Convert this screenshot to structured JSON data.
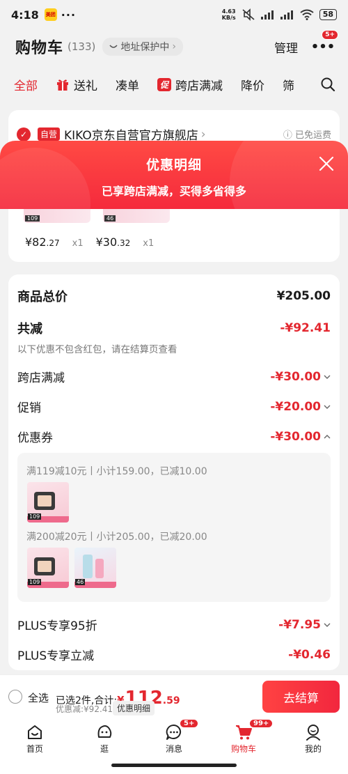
{
  "status_bar": {
    "time": "4:18",
    "app_badge": "美团",
    "dots": "···",
    "net_speed_value": "4.63",
    "net_speed_unit": "KB/s",
    "battery": "58"
  },
  "header": {
    "title": "购物车",
    "count": "(133)",
    "address_protect": "地址保护中",
    "manage": "管理",
    "more_badge": "5+"
  },
  "tabs": [
    {
      "label": "全部"
    },
    {
      "label": "送礼"
    },
    {
      "label": "凑单"
    },
    {
      "label": "跨店满减",
      "badge": "促"
    },
    {
      "label": "降价"
    },
    {
      "label": "筛"
    }
  ],
  "store": {
    "self_operated": "自营",
    "name": "KIKO京东自营官方旗舰店",
    "free_shipping": "已免运费",
    "items": [
      {
        "price_int": "¥82",
        "price_dec": ".27",
        "qty": "x1",
        "thumb_num": "109"
      },
      {
        "price_int": "¥30",
        "price_dec": ".32",
        "qty": "x1",
        "thumb_num": "46"
      }
    ]
  },
  "sheet": {
    "title": "优惠明细",
    "subtitle": "已享跨店满减，买得多省得多"
  },
  "detail": {
    "total_label": "商品总价",
    "total_value": "¥205.00",
    "reduce_label": "共减",
    "reduce_value": "-¥92.41",
    "note": "以下优惠不包含红包，请在结算页查看",
    "cross_store_label": "跨店满减",
    "cross_store_value": "-¥30.00",
    "promo_label": "促销",
    "promo_value": "-¥20.00",
    "coupon_label": "优惠券",
    "coupon_value": "-¥30.00",
    "coupon_lines": [
      {
        "text": "满119减10元丨小计159.00，已减10.00",
        "thumb_nums": [
          "109"
        ]
      },
      {
        "text": "满200减20元丨小计205.00，已减20.00",
        "thumb_nums": [
          "109",
          "46"
        ]
      }
    ],
    "plus95_label": "PLUS专享95折",
    "plus95_value": "-¥7.95",
    "plus_instant_label": "PLUS专享立减",
    "plus_instant_value": "-¥0.46"
  },
  "checkout": {
    "select_all": "全选",
    "selected_prefix": "已选2件,合计:",
    "yen": "¥",
    "total_int": "112",
    "total_dec": ".59",
    "discount_text": "优惠减:¥92.41",
    "detail_chip": "优惠明细",
    "button": "去结算"
  },
  "nav": [
    {
      "label": "首页",
      "icon": "home-icon"
    },
    {
      "label": "逛",
      "icon": "explore-icon"
    },
    {
      "label": "消息",
      "icon": "message-icon",
      "badge": "5+"
    },
    {
      "label": "购物车",
      "icon": "cart-icon",
      "badge": "99+"
    },
    {
      "label": "我的",
      "icon": "profile-icon"
    }
  ],
  "colors": {
    "accent": "#e3272f",
    "sheet_gradient_top": "#ff4a44",
    "sheet_gradient_bottom": "#f52a3c",
    "background": "#f2f2f2"
  }
}
